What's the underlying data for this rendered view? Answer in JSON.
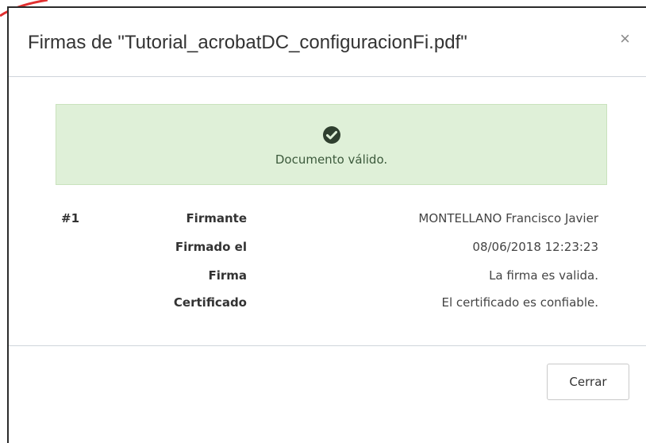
{
  "dialog": {
    "title": "Firmas de \"Tutorial_acrobatDC_configuracionFi.pdf\"",
    "close_glyph": "×"
  },
  "alert": {
    "icon": "check-circle-icon",
    "message": "Documento válido.",
    "colors": {
      "background": "#dff0d8",
      "icon": "#2f3f2f"
    }
  },
  "signature": {
    "index": "#1",
    "fields": [
      {
        "label": "Firmante",
        "value": "MONTELLANO Francisco Javier"
      },
      {
        "label": "Firmado el",
        "value": "08/06/2018 12:23:23"
      },
      {
        "label": "Firma",
        "value": "La firma es valida."
      },
      {
        "label": "Certificado",
        "value": "El certificado es confiable."
      }
    ]
  },
  "footer": {
    "close_button_label": "Cerrar"
  }
}
